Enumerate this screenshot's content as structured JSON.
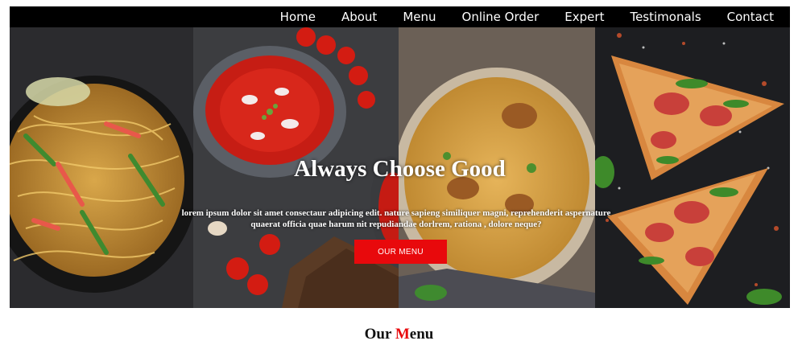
{
  "nav": {
    "items": [
      {
        "label": "Home"
      },
      {
        "label": "About"
      },
      {
        "label": "Menu"
      },
      {
        "label": "Online Order"
      },
      {
        "label": "Expert"
      },
      {
        "label": "Testimonals"
      },
      {
        "label": "Contact"
      }
    ]
  },
  "hero": {
    "headline": "Always Choose Good",
    "subtext": "lorem ipsum dolor sit amet consectaur adipicing edit. nature sapieng similiquer magni, reprehenderit aspernature quaerat officia quae harum nit repudiandae dorlrem, rationa , dolore neque?",
    "button_label": "OUR MENU",
    "panels": [
      {
        "name": "noodles"
      },
      {
        "name": "tomato-soup"
      },
      {
        "name": "biryani"
      },
      {
        "name": "pizza"
      }
    ]
  },
  "section": {
    "title_first": "Our ",
    "title_accent": "M",
    "title_rest": "enu"
  },
  "colors": {
    "accent": "#e8090c",
    "nav_bg": "#000000"
  }
}
